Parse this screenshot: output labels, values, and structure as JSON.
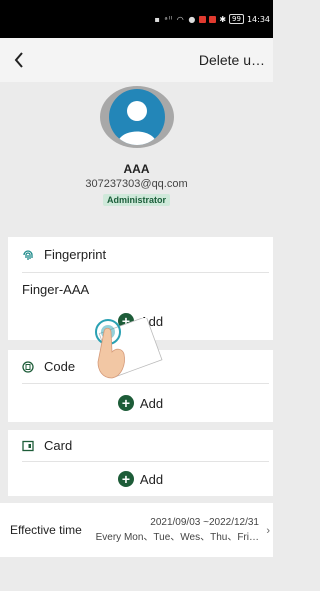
{
  "status_bar": {
    "icons": "▪ ᵃˡˡ ◠ ●",
    "time": "14:34",
    "battery": "99"
  },
  "header": {
    "back_icon": "chevron-left-icon",
    "action_label": "Delete u…"
  },
  "user": {
    "name": "AAA",
    "email": "307237303@qq.com",
    "role": "Administrator"
  },
  "fingerprint": {
    "title": "Fingerprint",
    "items": [
      "Finger-AAA"
    ],
    "add_label": "Add"
  },
  "code": {
    "title": "Code",
    "add_label": "Add"
  },
  "card": {
    "title": "Card",
    "add_label": "Add"
  },
  "effective": {
    "label": "Effective time",
    "date_range": "2021/09/03 ~2022/12/31",
    "days": "Every Mon、Tue、Wes、Thu、Fri…"
  },
  "colors": {
    "accent": "#1d5c38",
    "avatar_blue": "#2386b8",
    "fingerprint_teal": "#1e8a8a"
  }
}
